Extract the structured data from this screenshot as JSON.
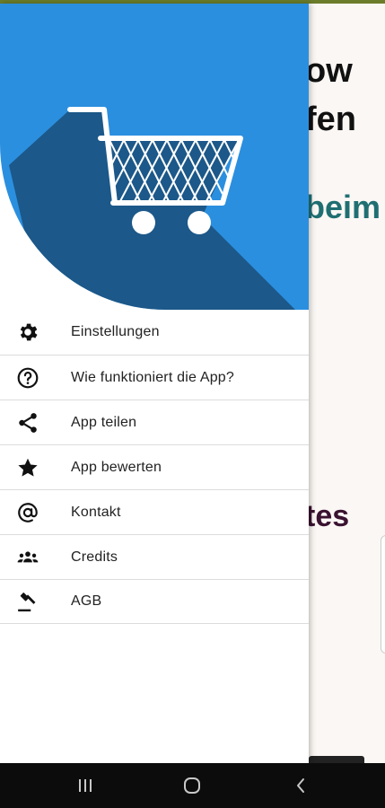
{
  "background_page": {
    "line1": "ow",
    "line2": "fen",
    "line3": "beim",
    "line4": "tes"
  },
  "drawer": {
    "header": {
      "logo_icon": "shopping-cart-icon",
      "colors": {
        "circle": "#2b8fdf",
        "shadow": "#1a4f7a"
      }
    },
    "items": [
      {
        "icon": "gear-icon",
        "label": "Einstellungen"
      },
      {
        "icon": "help-circle-icon",
        "label": "Wie funktioniert die App?"
      },
      {
        "icon": "share-icon",
        "label": "App teilen"
      },
      {
        "icon": "star-icon",
        "label": "App bewerten"
      },
      {
        "icon": "at-sign-icon",
        "label": "Kontakt"
      },
      {
        "icon": "people-icon",
        "label": "Credits"
      },
      {
        "icon": "gavel-icon",
        "label": "AGB"
      }
    ]
  },
  "navbar": {
    "recent_icon": "recent-apps-icon",
    "home_icon": "home-icon",
    "back_icon": "back-icon"
  }
}
